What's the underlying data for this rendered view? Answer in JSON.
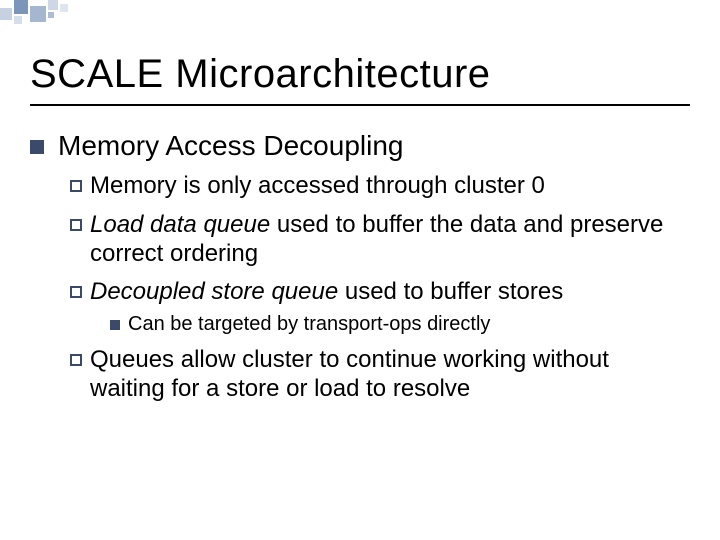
{
  "title": "SCALE Microarchitecture",
  "lvl1": "Memory Access Decoupling",
  "b1": "Memory is only accessed through cluster 0",
  "b2_i": "Load data queue",
  "b2_r": " used to buffer the data and preserve correct ordering",
  "b3_i": "Decoupled store queue",
  "b3_r": " used to buffer stores",
  "b3_sub": "Can be targeted by transport-ops directly",
  "b4": "Queues allow cluster to continue working without waiting for a store or load to resolve"
}
